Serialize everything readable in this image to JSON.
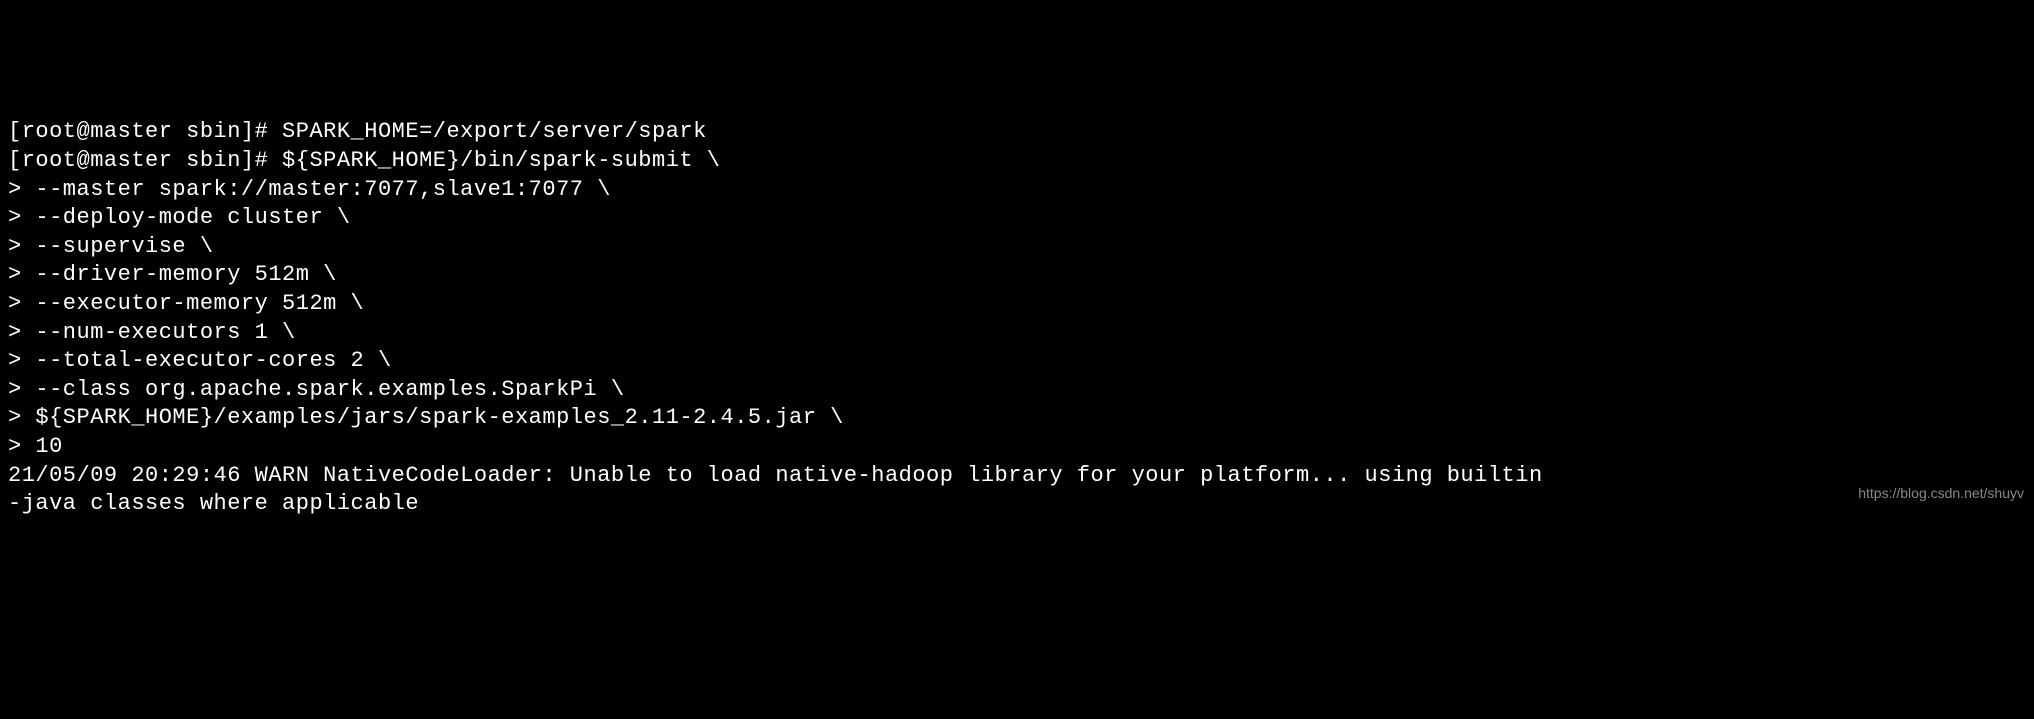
{
  "terminal": {
    "lines": [
      "[root@master sbin]# SPARK_HOME=/export/server/spark",
      "[root@master sbin]# ${SPARK_HOME}/bin/spark-submit \\",
      "> --master spark://master:7077,slave1:7077 \\",
      "> --deploy-mode cluster \\",
      "> --supervise \\",
      "> --driver-memory 512m \\",
      "> --executor-memory 512m \\",
      "> --num-executors 1 \\",
      "> --total-executor-cores 2 \\",
      "> --class org.apache.spark.examples.SparkPi \\",
      "> ${SPARK_HOME}/examples/jars/spark-examples_2.11-2.4.5.jar \\",
      "> 10",
      "21/05/09 20:29:46 WARN NativeCodeLoader: Unable to load native-hadoop library for your platform... using builtin",
      "-java classes where applicable"
    ]
  },
  "watermark": "https://blog.csdn.net/shuyv"
}
